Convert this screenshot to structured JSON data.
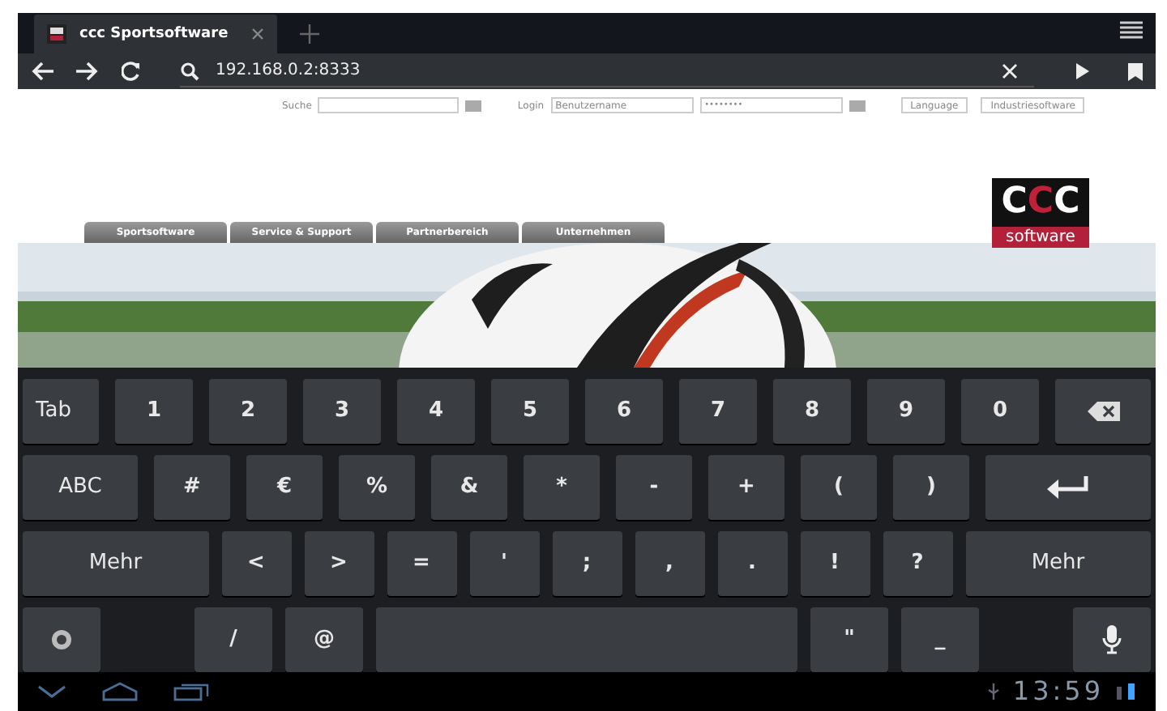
{
  "browser": {
    "tabs": [
      {
        "title": "ccc Sportsoftware",
        "selected": true
      }
    ],
    "url": "192.168.0.2:8333"
  },
  "page": {
    "search_label": "Suche",
    "login_label": "Login",
    "username_placeholder": "Benutzername",
    "password_value": "••••••••",
    "buttons": [
      "Language",
      "Industriesoftware"
    ],
    "nav_tabs": [
      "Sportsoftware",
      "Service & Support",
      "Partnerbereich",
      "Unternehmen"
    ],
    "logo": {
      "letters": [
        "C",
        "C",
        "C"
      ],
      "subtitle": "software"
    }
  },
  "keyboard": {
    "rows": [
      [
        {
          "kind": "key",
          "label": "Tab"
        },
        {
          "kind": "key",
          "label": "1"
        },
        {
          "kind": "key",
          "label": "2"
        },
        {
          "kind": "key",
          "label": "3"
        },
        {
          "kind": "key",
          "label": "4"
        },
        {
          "kind": "key",
          "label": "5"
        },
        {
          "kind": "key",
          "label": "6"
        },
        {
          "kind": "key",
          "label": "7"
        },
        {
          "kind": "key",
          "label": "8"
        },
        {
          "kind": "key",
          "label": "9"
        },
        {
          "kind": "key",
          "label": "0"
        },
        {
          "kind": "backspace"
        }
      ],
      [
        {
          "kind": "wide",
          "label": "ABC"
        },
        {
          "kind": "key",
          "label": "#"
        },
        {
          "kind": "key",
          "label": "€"
        },
        {
          "kind": "key",
          "label": "%"
        },
        {
          "kind": "key",
          "label": "&"
        },
        {
          "kind": "key",
          "label": "*"
        },
        {
          "kind": "key",
          "label": "-"
        },
        {
          "kind": "key",
          "label": "+"
        },
        {
          "kind": "key",
          "label": "("
        },
        {
          "kind": "key",
          "label": ")"
        },
        {
          "kind": "enter"
        }
      ],
      [
        {
          "kind": "wide",
          "label": "Mehr"
        },
        {
          "kind": "key",
          "label": "<"
        },
        {
          "kind": "key",
          "label": ">"
        },
        {
          "kind": "key",
          "label": "="
        },
        {
          "kind": "key",
          "label": "'"
        },
        {
          "kind": "key",
          "label": ";"
        },
        {
          "kind": "key",
          "label": ","
        },
        {
          "kind": "key",
          "label": "."
        },
        {
          "kind": "key",
          "label": "!"
        },
        {
          "kind": "key",
          "label": "?"
        },
        {
          "kind": "wide",
          "label": "Mehr"
        }
      ],
      [
        {
          "kind": "settings"
        },
        {
          "kind": "key",
          "label": "/"
        },
        {
          "kind": "key",
          "label": "@"
        },
        {
          "kind": "space"
        },
        {
          "kind": "key",
          "label": "\""
        },
        {
          "kind": "key",
          "label": "_"
        },
        {
          "kind": "mic"
        }
      ]
    ]
  },
  "status_bar": {
    "time": "13:59"
  }
}
